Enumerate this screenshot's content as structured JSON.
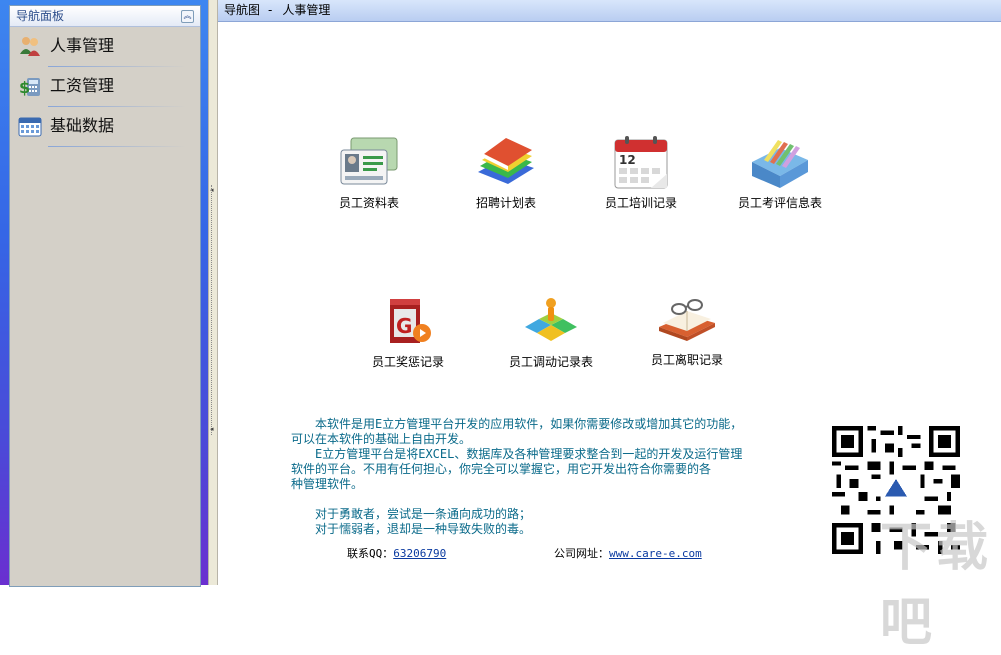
{
  "nav": {
    "title": "导航面板",
    "collapse_icon": "double-chevron-up-icon",
    "items": [
      {
        "label": "人事管理",
        "icon": "people-icon"
      },
      {
        "label": "工资管理",
        "icon": "money-calculator-icon"
      },
      {
        "label": "基础数据",
        "icon": "calendar-grid-icon"
      }
    ]
  },
  "header": {
    "prefix": "导航图",
    "dash": "-",
    "title": "人事管理"
  },
  "tiles": [
    {
      "label": "员工资料表",
      "icon": "id-cards-icon"
    },
    {
      "label": "招聘计划表",
      "icon": "books-stack-icon"
    },
    {
      "label": "员工培训记录",
      "icon": "calendar-12-icon"
    },
    {
      "label": "员工考评信息表",
      "icon": "file-tray-icon"
    },
    {
      "label": "员工奖惩记录",
      "icon": "red-box-icon"
    },
    {
      "label": "员工调动记录表",
      "icon": "puzzle-figure-icon"
    },
    {
      "label": "员工离职记录",
      "icon": "book-glasses-icon"
    }
  ],
  "info": {
    "line1": "　　本软件是用E立方管理平台开发的应用软件，如果你需要修改或增加其它的功能，",
    "line2": "可以在本软件的基础上自由开发。",
    "line3": "　　E立方管理平台是将EXCEL、数据库及各种管理要求整合到一起的开发及运行管理",
    "line4": "软件的平台。不用有任何担心，你完全可以掌握它，用它开发出符合你需要的各",
    "line5": "种管理软件。",
    "quote1": "　　对于勇敢者，尝试是一条通向成功的路；",
    "quote2": "　　对于懦弱者，退却是一种导致失败的毒。"
  },
  "contact": {
    "qq_label": "联系QQ：",
    "qq_value": "63206790",
    "site_label": "公司网址：",
    "site_value": "www.care-e.com"
  },
  "watermark": {
    "text": "下载吧"
  },
  "colors": {
    "info_text": "#0a6a8a",
    "nav_gradient_top": "#3d86f0",
    "nav_gradient_bottom": "#6a2fd0"
  }
}
